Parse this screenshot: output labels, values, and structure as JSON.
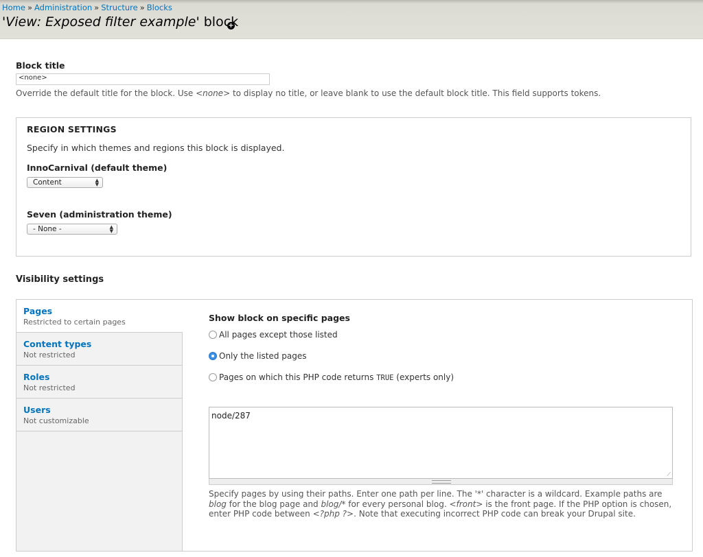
{
  "breadcrumb": {
    "items": [
      "Home",
      "Administration",
      "Structure",
      "Blocks"
    ],
    "separator": "»"
  },
  "page": {
    "title_prefix": "'",
    "title_italic": "View: Exposed filter example",
    "title_suffix": "' block"
  },
  "block_title": {
    "label": "Block title",
    "value": "<none>",
    "desc_before": "Override the default title for the block. Use ",
    "desc_none": "<none>",
    "desc_after": " to display no title, or leave blank to use the default block title. This field supports tokens."
  },
  "region_settings": {
    "legend": "REGION SETTINGS",
    "description": "Specify in which themes and regions this block is displayed.",
    "themes": [
      {
        "label": "InnoCarnival (default theme)",
        "selected": "Content"
      },
      {
        "label": "Seven (administration theme)",
        "selected": "- None -"
      }
    ]
  },
  "visibility": {
    "title": "Visibility settings",
    "tabs": [
      {
        "title": "Pages",
        "summary": "Restricted to certain pages"
      },
      {
        "title": "Content types",
        "summary": "Not restricted"
      },
      {
        "title": "Roles",
        "summary": "Not restricted"
      },
      {
        "title": "Users",
        "summary": "Not customizable"
      }
    ],
    "pages": {
      "title": "Show block on specific pages",
      "options": [
        {
          "label": "All pages except those listed",
          "checked": false
        },
        {
          "label": "Only the listed pages",
          "checked": true
        }
      ],
      "php_option": {
        "before": "Pages on which this PHP code returns ",
        "code": "TRUE",
        "after": " (experts only)"
      },
      "textarea_value": "node/287",
      "desc": {
        "p1": "Specify pages by using their paths. Enter one path per line. The '*' character is a wildcard. Example paths are ",
        "blog": "blog",
        "p2": " for the blog page and ",
        "blog_star": "blog/*",
        "p3": " for every personal blog. ",
        "front": "<front>",
        "p4": " is the front page. If the PHP option is chosen, enter PHP code between ",
        "php": "<?php ?>",
        "p5": ". Note that executing incorrect PHP code can break your Drupal site."
      }
    }
  },
  "colors": {
    "link": "#0074bd",
    "radio_checked": "#3d8fe6"
  }
}
